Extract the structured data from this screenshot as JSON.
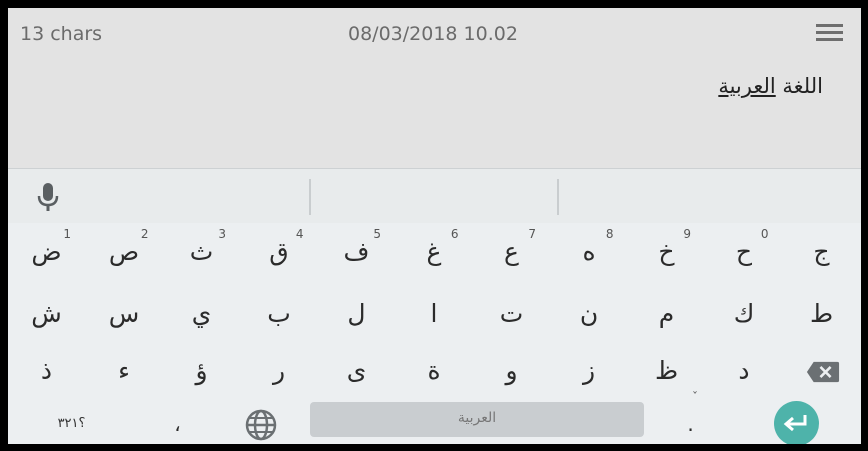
{
  "editor": {
    "char_count": "13 chars",
    "datetime": "08/03/2018 10.02",
    "text_first": "اللغة",
    "text_underlined": "العربية"
  },
  "icons": {
    "menu": "hamburger-menu-icon",
    "mic": "microphone-icon",
    "globe": "globe-icon",
    "backspace": "backspace-icon",
    "enter": "enter-icon"
  },
  "colors": {
    "accent": "#4eb3aa",
    "keyboard_bg": "#eceff1",
    "editor_bg": "#e3e3e3"
  },
  "keyboard": {
    "row1": [
      {
        "glyph": "ض",
        "hint": "1"
      },
      {
        "glyph": "ص",
        "hint": "2"
      },
      {
        "glyph": "ث",
        "hint": "3"
      },
      {
        "glyph": "ق",
        "hint": "4"
      },
      {
        "glyph": "ف",
        "hint": "5"
      },
      {
        "glyph": "غ",
        "hint": "6"
      },
      {
        "glyph": "ع",
        "hint": "7"
      },
      {
        "glyph": "ه",
        "hint": "8"
      },
      {
        "glyph": "خ",
        "hint": "9"
      },
      {
        "glyph": "ح",
        "hint": "0"
      },
      {
        "glyph": "ج",
        "hint": ""
      }
    ],
    "row2": [
      "ش",
      "س",
      "ي",
      "ب",
      "ل",
      "ا",
      "ت",
      "ن",
      "م",
      "ك",
      "ط"
    ],
    "row3": [
      "ذ",
      "ء",
      "ؤ",
      "ر",
      "ى",
      "ة",
      "و",
      "ز",
      "ظ",
      "د"
    ],
    "bottom": {
      "symbols_label": "؟٣٢١",
      "comma": "،",
      "space_label": "العربية",
      "period": ".",
      "period_hint": "ˇ"
    }
  }
}
